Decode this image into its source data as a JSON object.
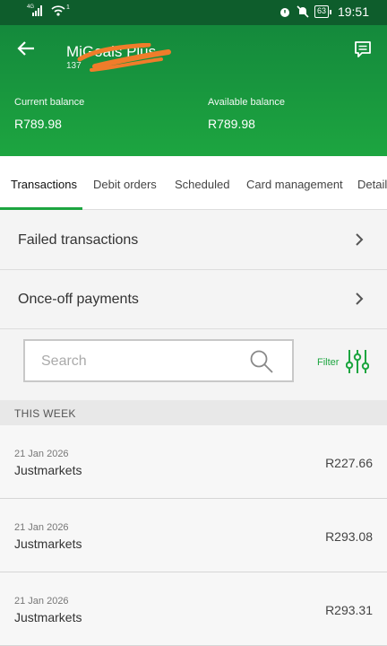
{
  "status_bar": {
    "network": "4G",
    "wifi_badge": "1",
    "battery": "63",
    "time": "19:51"
  },
  "header": {
    "account_name": "MiGoals Plus",
    "account_number": "137",
    "current_balance_label": "Current balance",
    "current_balance": "R789.98",
    "available_balance_label": "Available balance",
    "available_balance": "R789.98"
  },
  "tabs": [
    {
      "label": "Transactions",
      "active": true
    },
    {
      "label": "Debit orders"
    },
    {
      "label": "Scheduled"
    },
    {
      "label": "Card management"
    },
    {
      "label": "Details"
    }
  ],
  "rows": [
    {
      "label": "Failed transactions"
    },
    {
      "label": "Once-off payments"
    }
  ],
  "search": {
    "placeholder": "Search",
    "value": ""
  },
  "filter": {
    "label": "Filter"
  },
  "section_title": "THIS WEEK",
  "transactions": [
    {
      "date": "21 Jan 2026",
      "name": "Justmarkets",
      "amount": "R227.66"
    },
    {
      "date": "21 Jan 2026",
      "name": "Justmarkets",
      "amount": "R293.08"
    },
    {
      "date": "21 Jan 2026",
      "name": "Justmarkets",
      "amount": "R293.31"
    }
  ],
  "colors": {
    "brand_green": "#1da540",
    "status_bar": "#0e5d2c",
    "redaction": "#f07c2a"
  }
}
